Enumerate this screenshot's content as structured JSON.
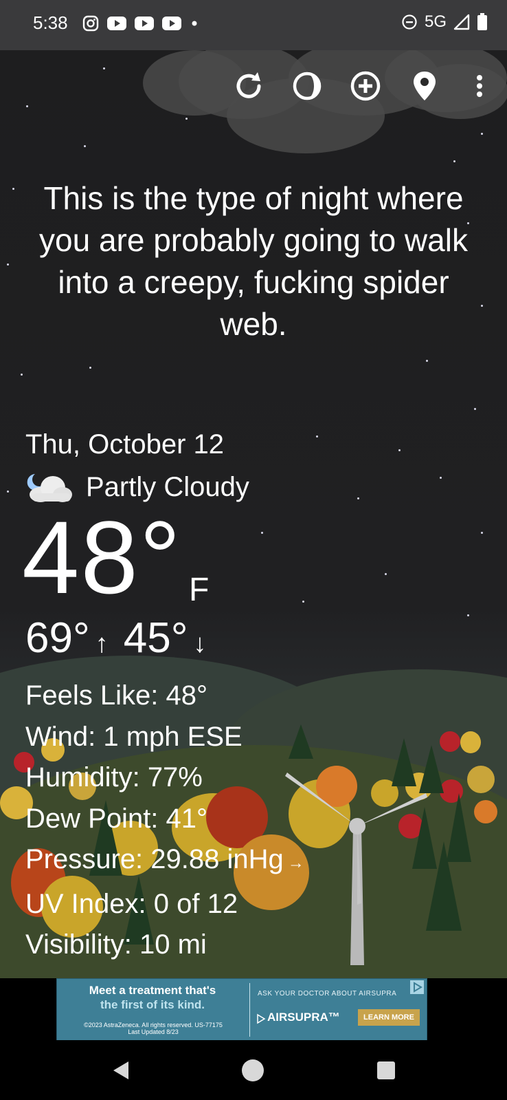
{
  "status_bar": {
    "time": "5:38",
    "left_icons": [
      "instagram-icon",
      "youtube-icon",
      "youtube-icon",
      "youtube-icon",
      "dot-icon"
    ],
    "network": "5G"
  },
  "toolbar": {
    "icons": [
      "refresh-icon",
      "moon-phase-icon",
      "add-location-icon",
      "location-pin-icon",
      "overflow-menu-icon"
    ]
  },
  "quote": "This is the type of night where you are probably going to walk into a creepy, fucking spider web.",
  "weather": {
    "date": "Thu, October 12",
    "condition": "Partly Cloudy",
    "condition_icon": "partly-cloudy-night-icon",
    "temperature": "48°",
    "unit": "F",
    "high": "69°",
    "high_arrow": "↑",
    "low": "45°",
    "low_arrow": "↓",
    "details": {
      "feels_like": "Feels Like:  48°",
      "wind": "Wind:  1 mph ESE",
      "humidity": "Humidity:  77%",
      "dew_point": "Dew Point:  41°",
      "pressure": "Pressure:  29.88 inHg",
      "pressure_trend": "→",
      "uv_index": "UV Index:  0 of 12",
      "visibility": "Visibility:  10 mi"
    }
  },
  "ad": {
    "headline": "Meet a treatment that's",
    "headline2": "the first of its kind.",
    "fine_print": "©2023 AstraZeneca. All rights reserved. US-77175 Last Updated 8/23",
    "ask": "ASK YOUR DOCTOR ABOUT AIRSUPRA",
    "brand": "AIRSUPRA™",
    "cta": "LEARN MORE"
  },
  "colors": {
    "status_bar": "#3a3a3c",
    "sky": "#1e1e1f",
    "ad_bg": "#3e7f96",
    "ad_cta": "#c8a34c"
  }
}
